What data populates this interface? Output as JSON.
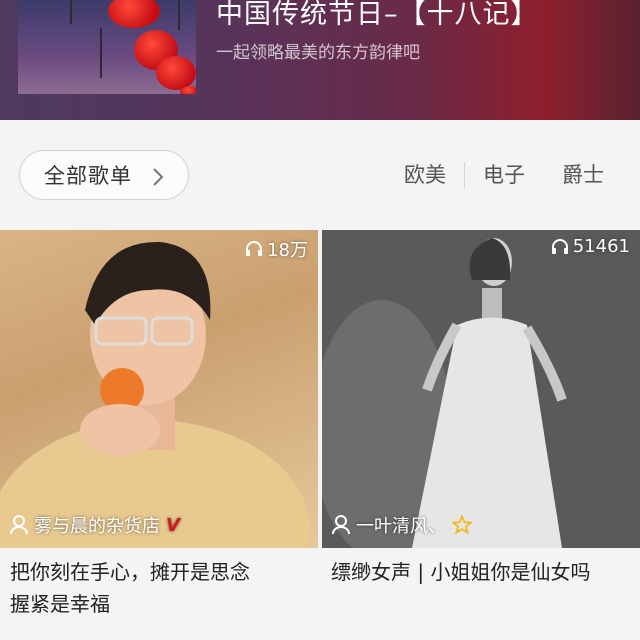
{
  "banner": {
    "title": "中国传统节日–【十八记】",
    "subtitle": "一起领略最美的东方韵律吧",
    "thumb_icon": "red-lanterns-image"
  },
  "filter": {
    "all_lists_label": "全部歌单",
    "tags": [
      "欧美",
      "电子",
      "爵士"
    ]
  },
  "playlists": [
    {
      "play_count": "18万",
      "owner": "雾与晨的杂货店",
      "owner_badge": "V",
      "title": "把你刻在手心，摊开是思念\n握紧是幸福",
      "title_line1": "把你刻在手心，摊开是思念",
      "title_line2": "握紧是幸福"
    },
    {
      "play_count": "51461",
      "owner": "一叶清风、",
      "owner_badge": "star",
      "title_line1": "缥缈女声 | 小姐姐你是仙女吗",
      "title_line2": ""
    }
  ],
  "colors": {
    "accent_red": "#d4181f",
    "star_gold": "#f3b61f"
  }
}
